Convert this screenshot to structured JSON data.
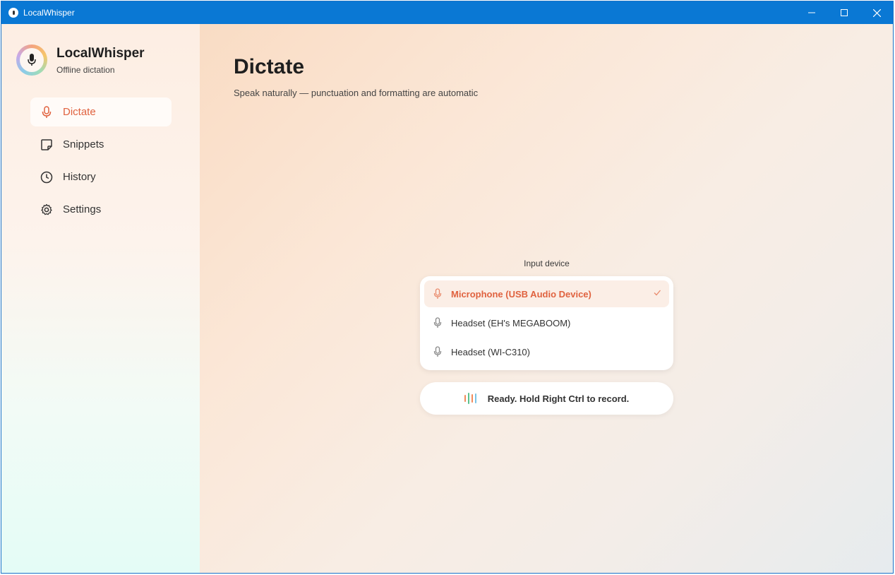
{
  "window": {
    "title": "LocalWhisper"
  },
  "sidebar": {
    "brand_name": "LocalWhisper",
    "brand_sub": "Offline dictation",
    "items": [
      {
        "label": "Dictate",
        "icon": "mic-icon",
        "active": true
      },
      {
        "label": "Snippets",
        "icon": "note-icon",
        "active": false
      },
      {
        "label": "History",
        "icon": "clock-icon",
        "active": false
      },
      {
        "label": "Settings",
        "icon": "gear-icon",
        "active": false
      }
    ]
  },
  "main": {
    "title": "Dictate",
    "subtitle": "Speak naturally — punctuation and formatting are automatic",
    "input_device_label": "Input device",
    "devices": [
      {
        "label": "Microphone (USB Audio Device)",
        "selected": true
      },
      {
        "label": "Headset (EH's MEGABOOM)",
        "selected": false
      },
      {
        "label": "Headset (WI-C310)",
        "selected": false
      }
    ],
    "status": "Ready. Hold Right Ctrl to record."
  },
  "colors": {
    "accent": "#e0623f",
    "titlebar": "#0a78d4",
    "wave": [
      "#f28a5b",
      "#5cc28d",
      "#f28a5b",
      "#7ac4e6"
    ]
  }
}
